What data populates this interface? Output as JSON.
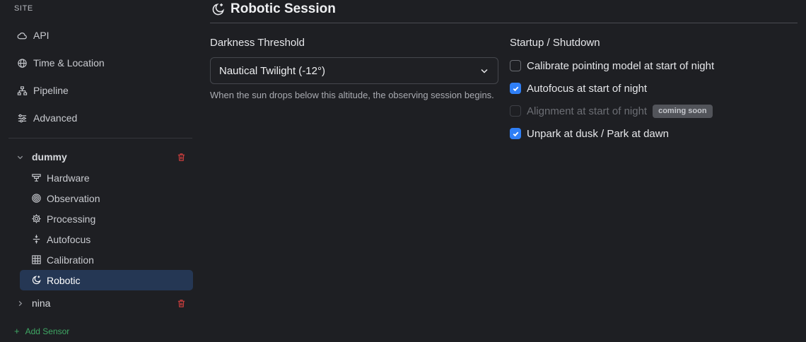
{
  "sidebar": {
    "section_label": "SITE",
    "site_items": [
      {
        "label": "API",
        "icon": "cloud-icon"
      },
      {
        "label": "Time & Location",
        "icon": "globe-icon"
      },
      {
        "label": "Pipeline",
        "icon": "pipeline-icon"
      },
      {
        "label": "Advanced",
        "icon": "sliders-icon"
      }
    ],
    "sensors": [
      {
        "name": "dummy",
        "expanded": true,
        "items": [
          {
            "label": "Hardware",
            "icon": "hardware-icon"
          },
          {
            "label": "Observation",
            "icon": "target-icon"
          },
          {
            "label": "Processing",
            "icon": "cog-icon"
          },
          {
            "label": "Autofocus",
            "icon": "autofocus-icon"
          },
          {
            "label": "Calibration",
            "icon": "grid-icon"
          },
          {
            "label": "Robotic",
            "icon": "moon-stars-icon",
            "active": true
          }
        ]
      },
      {
        "name": "nina",
        "expanded": false
      }
    ],
    "add_sensor_label": "Add Sensor"
  },
  "main": {
    "title": "Robotic Session",
    "title_icon": "moon-stars-icon",
    "darkness": {
      "label": "Darkness Threshold",
      "selected": "Nautical Twilight (-12°)",
      "helper": "When the sun drops below this altitude, the observing session begins."
    },
    "startup": {
      "label": "Startup / Shutdown",
      "options": [
        {
          "label": "Calibrate pointing model at start of night",
          "checked": false,
          "disabled": false
        },
        {
          "label": "Autofocus at start of night",
          "checked": true,
          "disabled": false
        },
        {
          "label": "Alignment at start of night",
          "checked": false,
          "disabled": true,
          "badge": "coming soon"
        },
        {
          "label": "Unpark at dusk / Park at dawn",
          "checked": true,
          "disabled": false
        }
      ]
    }
  },
  "colors": {
    "background": "#1e1f23",
    "active_bg": "#253754",
    "accent": "#2f7ff6",
    "danger": "#d9403f",
    "success": "#3fa764"
  }
}
